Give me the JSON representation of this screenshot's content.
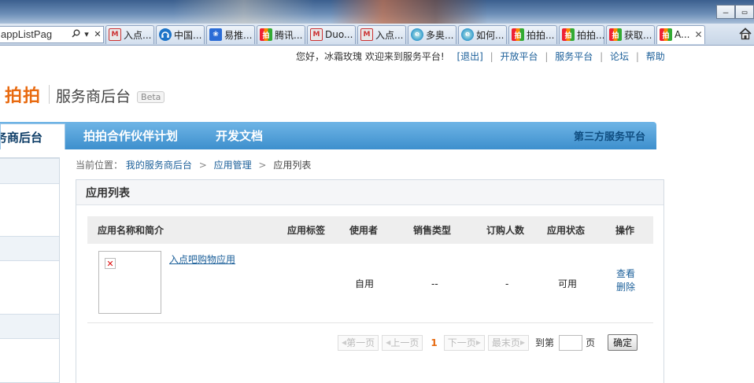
{
  "browser": {
    "address": "appListPag",
    "tabs": [
      {
        "label": "入点...",
        "icon": "m-icon"
      },
      {
        "label": "中国...",
        "icon": "headset-icon"
      },
      {
        "label": "易推...",
        "icon": "paw-icon"
      },
      {
        "label": "腾讯...",
        "icon": "paipai-icon"
      },
      {
        "label": "Duo...",
        "icon": "m-icon"
      },
      {
        "label": "入点...",
        "icon": "m-icon"
      },
      {
        "label": "多奥...",
        "icon": "ie-icon"
      },
      {
        "label": "如何...",
        "icon": "ie-icon"
      },
      {
        "label": "拍拍...",
        "icon": "paipai-icon"
      },
      {
        "label": "拍拍...",
        "icon": "paipai-icon"
      },
      {
        "label": "获取...",
        "icon": "paipai-icon"
      },
      {
        "label": "A...",
        "icon": "paipai-icon"
      }
    ],
    "minimize": "–",
    "restore": "▭",
    "tab_close": "✕",
    "addr_close": "✕"
  },
  "topnav": {
    "greeting": "您好，冰霜玫瑰  欢迎来到服务平台!",
    "logout": "[退出]",
    "links": [
      "开放平台",
      "服务平台",
      "论坛",
      "帮助"
    ]
  },
  "header": {
    "logo": "拍拍",
    "title": "服务商后台",
    "beta": "Beta"
  },
  "mainnav": {
    "current": "服务商后台",
    "items": [
      "拍拍合作伙伴计划",
      "开发文档"
    ],
    "right": "第三方服务平台"
  },
  "breadcrumb": {
    "prefix": "当前位置：",
    "links": [
      "我的服务商后台",
      "应用管理"
    ],
    "current": "应用列表"
  },
  "panel": {
    "title": "应用列表",
    "columns": [
      "应用名称和简介",
      "应用标签",
      "使用者",
      "销售类型",
      "订购人数",
      "应用状态",
      "操作"
    ],
    "rows": [
      {
        "name": "入点吧购物应用",
        "tag": "",
        "user": "自用",
        "sale_type": "--",
        "subscribers": "-",
        "status": "可用",
        "actions": [
          "查看",
          "删除"
        ]
      }
    ]
  },
  "pager": {
    "first": "第一页",
    "prev": "上一页",
    "current": "1",
    "next": "下一页",
    "last": "最末页",
    "goto_label": "到第",
    "page_unit": "页",
    "ok": "确定"
  },
  "colors": {
    "logo": "#e86a10",
    "nav_blue": "#3d8fcd",
    "link": "#1b5f99"
  }
}
